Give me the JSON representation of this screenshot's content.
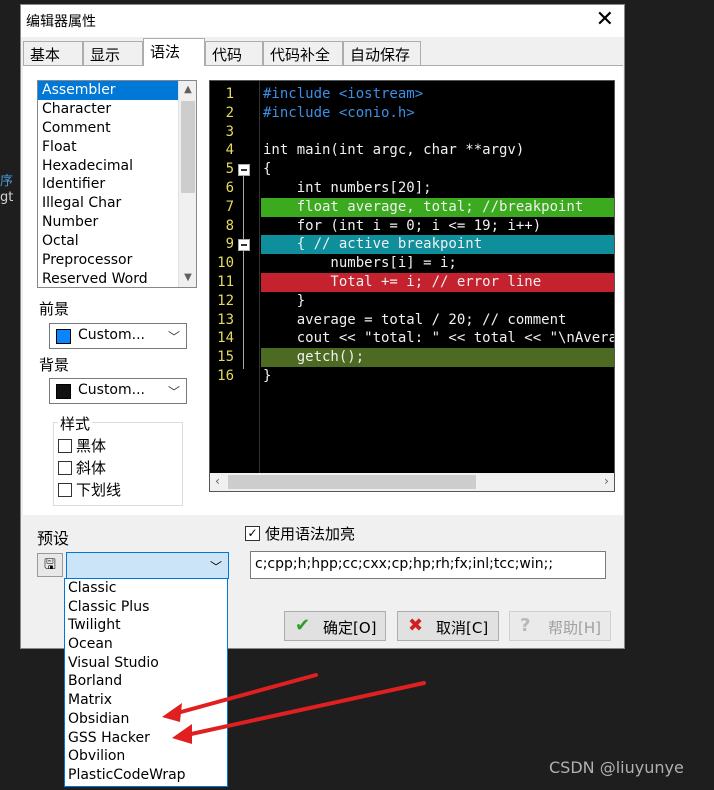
{
  "background": {
    "left_text_1": "序",
    "left_text_2": "gt"
  },
  "window": {
    "title": "编辑器属性",
    "close_icon": "close-icon"
  },
  "tabs": [
    {
      "label": "基本",
      "active": false
    },
    {
      "label": "显示",
      "active": false
    },
    {
      "label": "语法",
      "active": true
    },
    {
      "label": "代码",
      "active": false
    },
    {
      "label": "代码补全",
      "active": false
    },
    {
      "label": "自动保存",
      "active": false
    }
  ],
  "syntax_list": {
    "items": [
      "Assembler",
      "Character",
      "Comment",
      "Float",
      "Hexadecimal",
      "Identifier",
      "Illegal Char",
      "Number",
      "Octal",
      "Preprocessor",
      "Reserved Word"
    ],
    "selected": "Assembler"
  },
  "foreground": {
    "label": "前景",
    "value": "Custom...",
    "swatch_color": "#0a84ff"
  },
  "background_color": {
    "label": "背景",
    "value": "Custom...",
    "swatch_color": "#111111"
  },
  "style_group": {
    "title": "样式",
    "options": [
      {
        "label": "黑体",
        "checked": false
      },
      {
        "label": "斜体",
        "checked": false
      },
      {
        "label": "下划线",
        "checked": false
      }
    ]
  },
  "code_preview": {
    "lines": [
      {
        "n": "1",
        "text": "#include <iostream>"
      },
      {
        "n": "2",
        "text": "#include <conio.h>"
      },
      {
        "n": "3",
        "text": ""
      },
      {
        "n": "4",
        "text": "int main(int argc, char **argv)"
      },
      {
        "n": "5",
        "text": "{"
      },
      {
        "n": "6",
        "text": "    int numbers[20];"
      },
      {
        "n": "7",
        "text": "    float average, total; //breakpoint"
      },
      {
        "n": "8",
        "text": "    for (int i = 0; i <= 19; i++)"
      },
      {
        "n": "9",
        "text": "    { // active breakpoint"
      },
      {
        "n": "10",
        "text": "        numbers[i] = i;"
      },
      {
        "n": "11",
        "text": "        Total += i; // error line"
      },
      {
        "n": "12",
        "text": "    }"
      },
      {
        "n": "13",
        "text": "    average = total / 20; // comment"
      },
      {
        "n": "14",
        "text": "    cout << \"total: \" << total << \"\\nAverage"
      },
      {
        "n": "15",
        "text": "    getch();"
      },
      {
        "n": "16",
        "text": "}"
      }
    ]
  },
  "presets": {
    "label": "预设",
    "value": "",
    "options": [
      "Classic",
      "Classic Plus",
      "Twilight",
      "Ocean",
      "Visual Studio",
      "Borland",
      "Matrix",
      "Obsidian",
      "GSS Hacker",
      "Obvilion",
      "PlasticCodeWrap"
    ]
  },
  "syntax_highlight": {
    "label": "使用语法加亮",
    "checked": true
  },
  "extensions": {
    "value": "c;cpp;h;hpp;cc;cxx;cp;hp;rh;fx;inl;tcc;win;;"
  },
  "buttons": {
    "ok": "确定[O]",
    "cancel": "取消[C]",
    "help": "帮助[H]"
  },
  "watermark": "CSDN @liuyunye"
}
